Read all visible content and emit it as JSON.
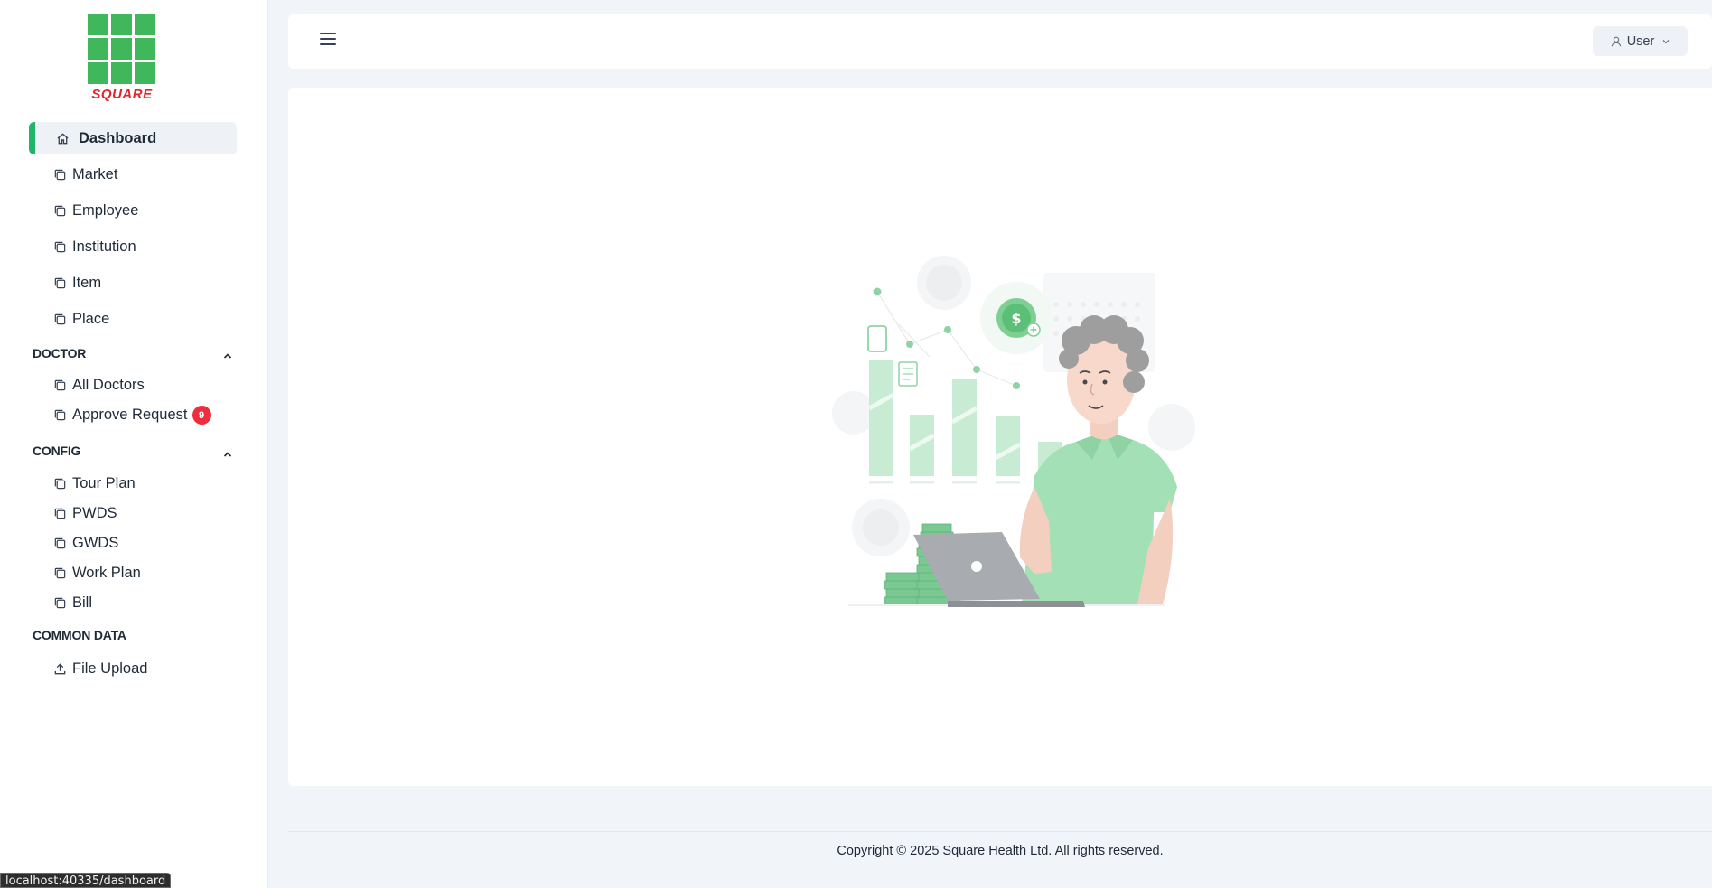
{
  "brand": {
    "logo_text": "SQUARE",
    "logo_color": "#3fb75a",
    "logo_text_color": "#e3262c"
  },
  "sidebar": {
    "active": {
      "label": "Dashboard",
      "icon": "home-icon"
    },
    "items": [
      {
        "label": "Market",
        "icon": "copy-icon"
      },
      {
        "label": "Employee",
        "icon": "copy-icon"
      },
      {
        "label": "Institution",
        "icon": "copy-icon"
      },
      {
        "label": "Item",
        "icon": "copy-icon"
      },
      {
        "label": "Place",
        "icon": "copy-icon"
      }
    ],
    "sections": {
      "doctor": {
        "title": "DOCTOR",
        "items": [
          {
            "label": "All Doctors",
            "icon": "copy-icon"
          },
          {
            "label": "Approve Request",
            "icon": "copy-icon",
            "badge": "9"
          }
        ]
      },
      "config": {
        "title": "CONFIG",
        "items": [
          {
            "label": "Tour Plan",
            "icon": "copy-icon"
          },
          {
            "label": "PWDS",
            "icon": "copy-icon"
          },
          {
            "label": "GWDS",
            "icon": "copy-icon"
          },
          {
            "label": "Work Plan",
            "icon": "copy-icon"
          },
          {
            "label": "Bill",
            "icon": "copy-icon"
          }
        ]
      },
      "common": {
        "title": "COMMON DATA",
        "items": [
          {
            "label": "File Upload",
            "icon": "upload-icon"
          }
        ]
      }
    }
  },
  "header": {
    "user_label": "User"
  },
  "footer": {
    "copyright": "Copyright © 2025 Square Health Ltd. All rights reserved."
  },
  "statusbar": {
    "url": "localhost:40335/dashboard"
  },
  "colors": {
    "accent": "#1fb56b",
    "badge": "#ee2d3d",
    "background": "#f1f4f8"
  }
}
